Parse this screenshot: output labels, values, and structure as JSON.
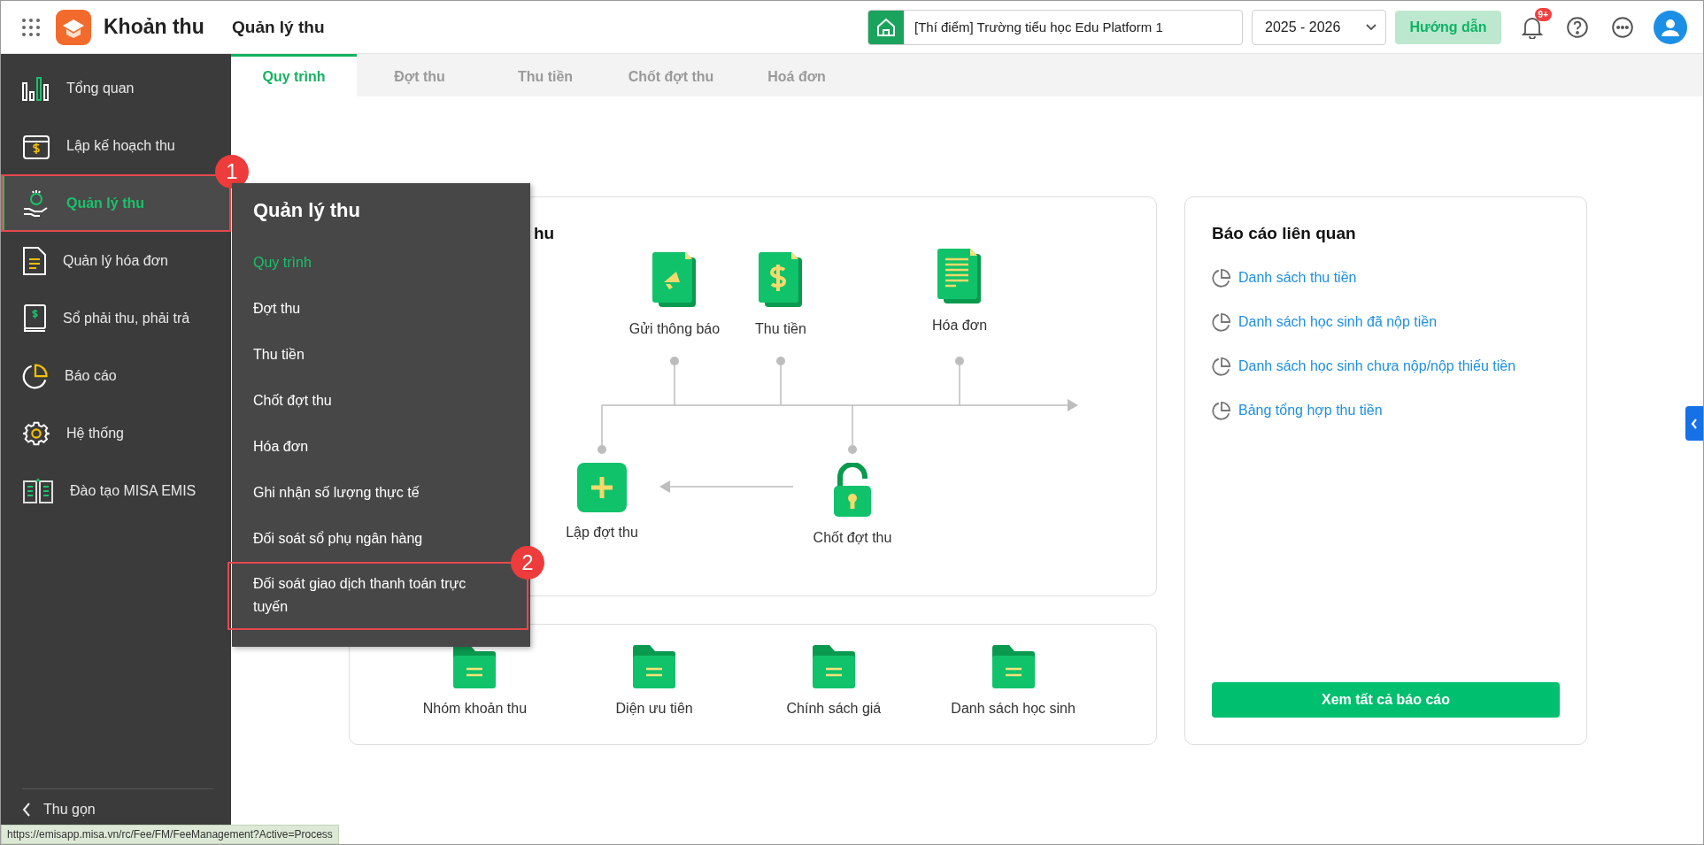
{
  "app": {
    "title": "Khoản thu"
  },
  "page_title": "Quản lý thu",
  "school_selector": {
    "value": "[Thí điểm] Trường tiểu học Edu Platform 1"
  },
  "year_select": {
    "value": "2025 - 2026"
  },
  "guide_button": "Hướng dẫn",
  "notification_badge": "9+",
  "tabs": [
    {
      "label": "Quy trình",
      "selected": true
    },
    {
      "label": "Đợt thu",
      "selected": false
    },
    {
      "label": "Thu tiền",
      "selected": false
    },
    {
      "label": "Chốt đợt thu",
      "selected": false
    },
    {
      "label": "Hoá đơn",
      "selected": false
    }
  ],
  "sidebar": {
    "items": [
      {
        "label": "Tổng quan",
        "selected": false
      },
      {
        "label": "Lập kế hoạch thu",
        "selected": false
      },
      {
        "label": "Quản lý thu",
        "selected": true,
        "callout": "1"
      },
      {
        "label": "Quản lý hóa đơn",
        "selected": false
      },
      {
        "label": "Sổ phải thu, phải trả",
        "selected": false
      },
      {
        "label": "Báo cáo",
        "selected": false
      },
      {
        "label": "Hệ thống",
        "selected": false
      },
      {
        "label": "Đào tạo MISA EMIS",
        "selected": false
      }
    ],
    "collapse": "Thu gọn"
  },
  "flyout": {
    "title": "Quản lý thu",
    "items": [
      {
        "label": "Quy trình",
        "selected": true
      },
      {
        "label": "Đợt thu",
        "selected": false
      },
      {
        "label": "Thu tiền",
        "selected": false
      },
      {
        "label": "Chốt đợt thu",
        "selected": false
      },
      {
        "label": "Hóa đơn",
        "selected": false
      },
      {
        "label": "Ghi nhận số lượng thực tế",
        "selected": false
      },
      {
        "label": "Đối soát sổ phụ ngân hàng",
        "selected": false
      },
      {
        "label": "Đối soát giao dịch thanh toán trực tuyến",
        "selected": false,
        "callout": "2"
      }
    ]
  },
  "process_card": {
    "title": "hu",
    "steps": [
      {
        "label": "Gửi thông báo"
      },
      {
        "label": "Thu tiền"
      },
      {
        "label": "Hóa đơn"
      },
      {
        "label": "Lập đợt thu"
      },
      {
        "label": "Chốt đợt thu"
      }
    ]
  },
  "catalog_card": {
    "items": [
      "Nhóm khoản thu",
      "Diện ưu tiên",
      "Chính sách giá",
      "Danh sách học sinh"
    ]
  },
  "reports": {
    "title": "Báo cáo liên quan",
    "links": [
      "Danh sách thu tiền",
      "Danh sách học sinh đã nộp tiền",
      "Danh sách học sinh chưa nộp/nộp thiếu tiền",
      "Bảng tổng hợp thu tiền"
    ],
    "button": "Xem tất cả báo cáo"
  },
  "status_url": "https://emisapp.misa.vn/rc/Fee/FM/FeeManagement?Active=Process"
}
